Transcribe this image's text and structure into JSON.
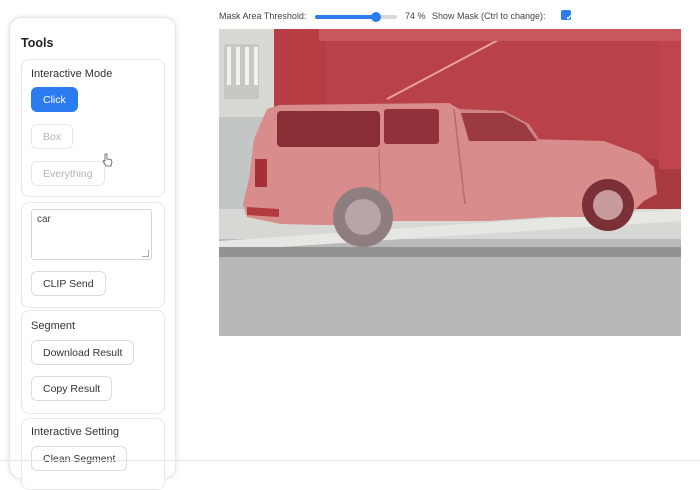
{
  "topbar": {
    "threshold_label": "Mask Area Threshold:",
    "threshold_value_text": "74 %",
    "threshold_value": 0.74,
    "show_mask_label": "Show Mask (Ctrl to change):",
    "show_mask_checked": true
  },
  "tools": {
    "title": "Tools",
    "interactive_mode": {
      "label": "Interactive Mode",
      "buttons": [
        "Click",
        "Box",
        "Everything"
      ],
      "active": "Click"
    },
    "clip": {
      "text_value": "car",
      "send_label": "CLIP Send"
    },
    "segment": {
      "label": "Segment",
      "download_label": "Download Result",
      "copy_label": "Copy Result"
    },
    "interactive_setting": {
      "label": "Interactive Setting",
      "clean_label": "Clean Segment"
    }
  },
  "colors": {
    "accent": "#2b7cf0",
    "mask": "#d23a46"
  }
}
